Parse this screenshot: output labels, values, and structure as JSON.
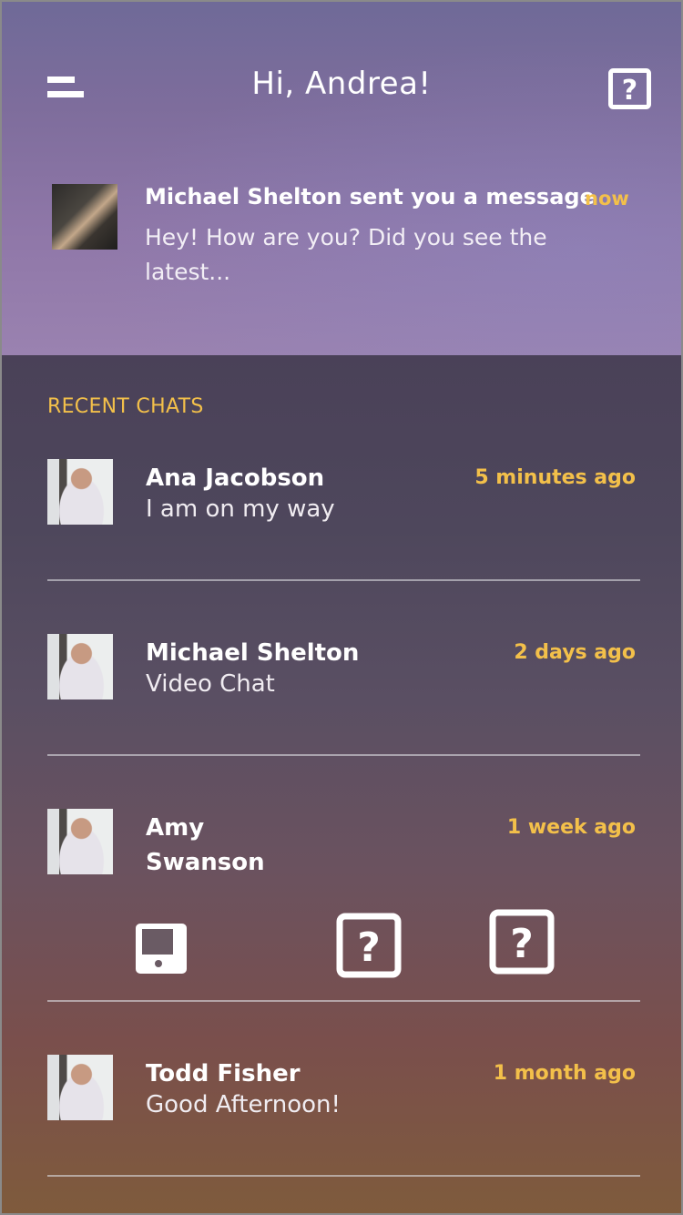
{
  "header": {
    "title": "Hi, Andrea!",
    "menu_icon": "menu-icon",
    "help_icon": "help-icon"
  },
  "notification": {
    "title": "Michael Shelton sent you a message",
    "body": "Hey! How are you? Did you see the latest...",
    "time": "now"
  },
  "recent": {
    "title": "RECENT CHATS",
    "chats": [
      {
        "name": "Ana Jacobson",
        "message": "I am on my way",
        "time": "5 minutes ago"
      },
      {
        "name": "Michael Shelton",
        "message": "Video Chat",
        "time": "2 days ago"
      },
      {
        "name": "Amy Swanson",
        "message": "",
        "time": "1 week ago"
      },
      {
        "name": "Todd Fisher",
        "message": "Good Afternoon!",
        "time": "1 month ago"
      }
    ]
  },
  "actions": [
    {
      "icon": "tablet-icon"
    },
    {
      "icon": "help-icon"
    },
    {
      "icon": "help-icon"
    }
  ],
  "colors": {
    "accent": "#f3c04a",
    "text": "#ffffff"
  }
}
